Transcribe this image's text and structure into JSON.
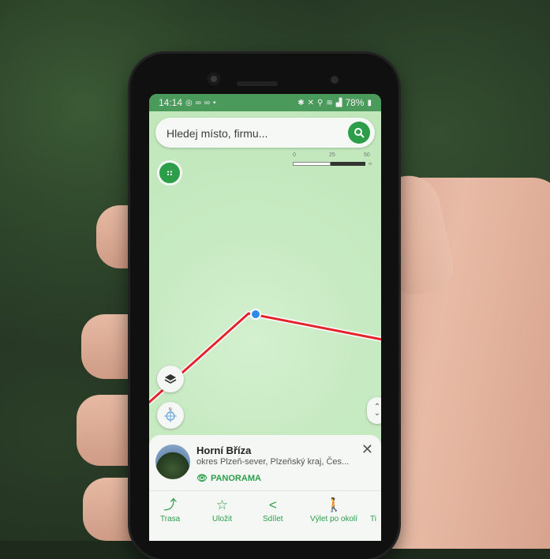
{
  "status_bar": {
    "time": "14:14",
    "left_icons": [
      "whatsapp-icon",
      "voicemail-icon",
      "voicemail-icon",
      "dot-icon"
    ],
    "right_icons": [
      "bluetooth-icon",
      "mute-icon",
      "location-icon",
      "wifi-icon",
      "signal-icon"
    ],
    "battery": "78%"
  },
  "search": {
    "placeholder": "Hledej místo, firmu..."
  },
  "scale": {
    "labels": [
      "0",
      "25",
      "50"
    ],
    "unit": "m"
  },
  "info_card": {
    "title": "Horní Bříza",
    "subtitle": "okres Plzeň-sever, Plzeňský kraj, Čes...",
    "panorama_label": "PANORAMA"
  },
  "actions": [
    {
      "label": "Trasa",
      "icon": "route-icon"
    },
    {
      "label": "Uložit",
      "icon": "star-icon"
    },
    {
      "label": "Sdílet",
      "icon": "share-icon"
    },
    {
      "label": "Výlet po okolí",
      "icon": "hiking-icon"
    },
    {
      "label": "Ti",
      "icon": "more-icon"
    }
  ],
  "colors": {
    "accent": "#2c9e4a",
    "route": "#e2252b",
    "status_bar": "#4a9a5c",
    "map_bg": "#c7eac2",
    "location_dot": "#2b8be6"
  }
}
